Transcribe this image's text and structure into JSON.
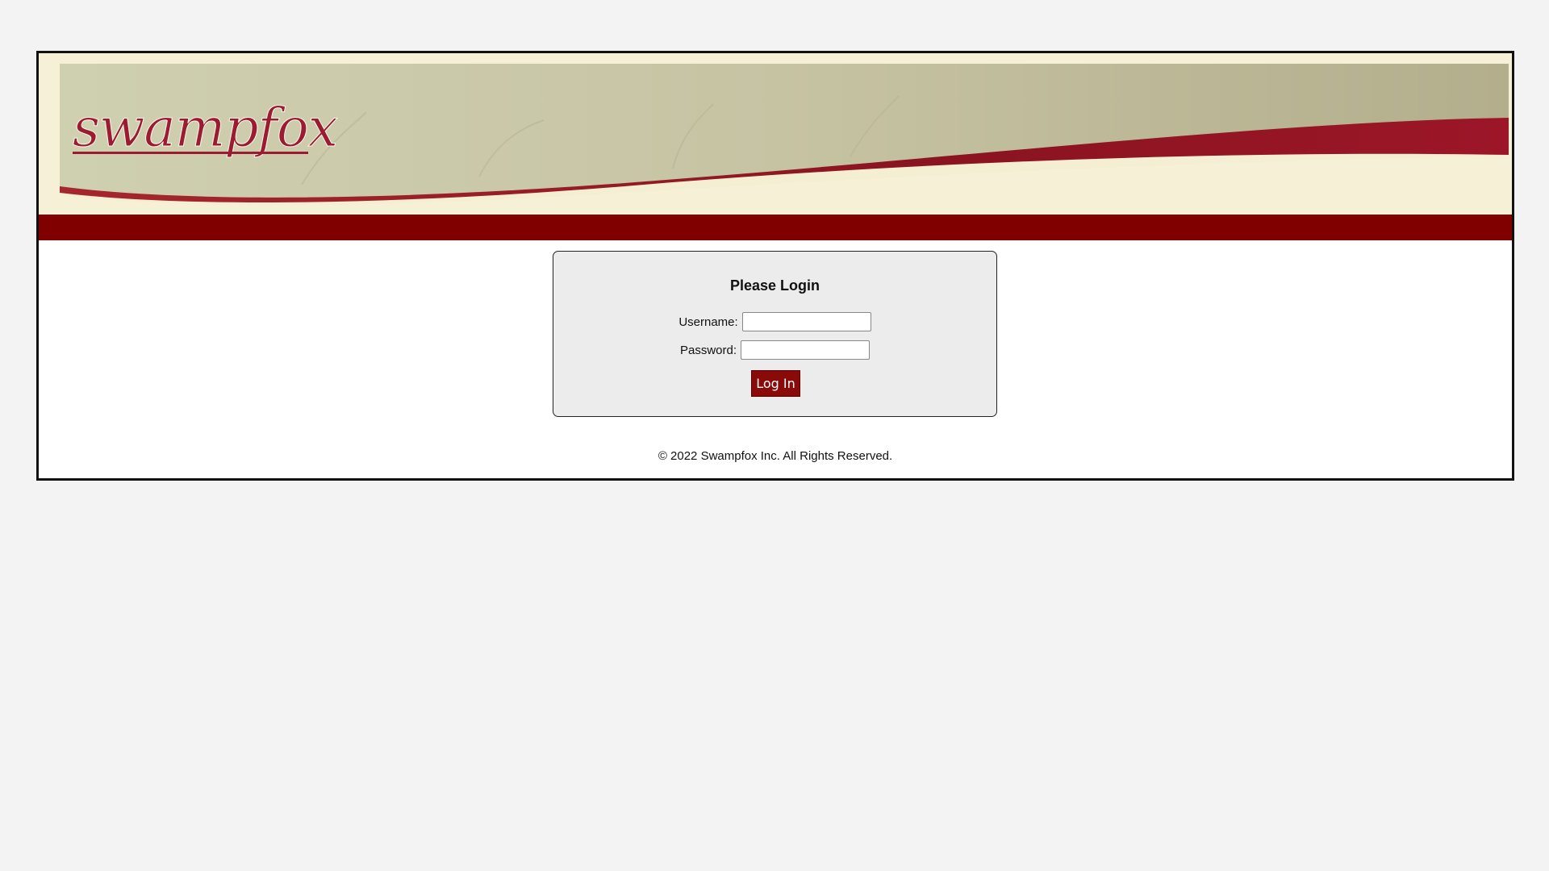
{
  "header": {
    "logo_text": "swampfox"
  },
  "login": {
    "title": "Please Login",
    "username_label": "Username:",
    "username_value": "",
    "password_label": "Password:",
    "password_value": "",
    "button_label": "Log In"
  },
  "footer": {
    "copyright": "© 2022 Swampfox Inc. All Rights Reserved."
  },
  "colors": {
    "brand_red": "#800000",
    "banner_bg": "#f6f1d6",
    "page_bg": "#f3f3f3"
  }
}
